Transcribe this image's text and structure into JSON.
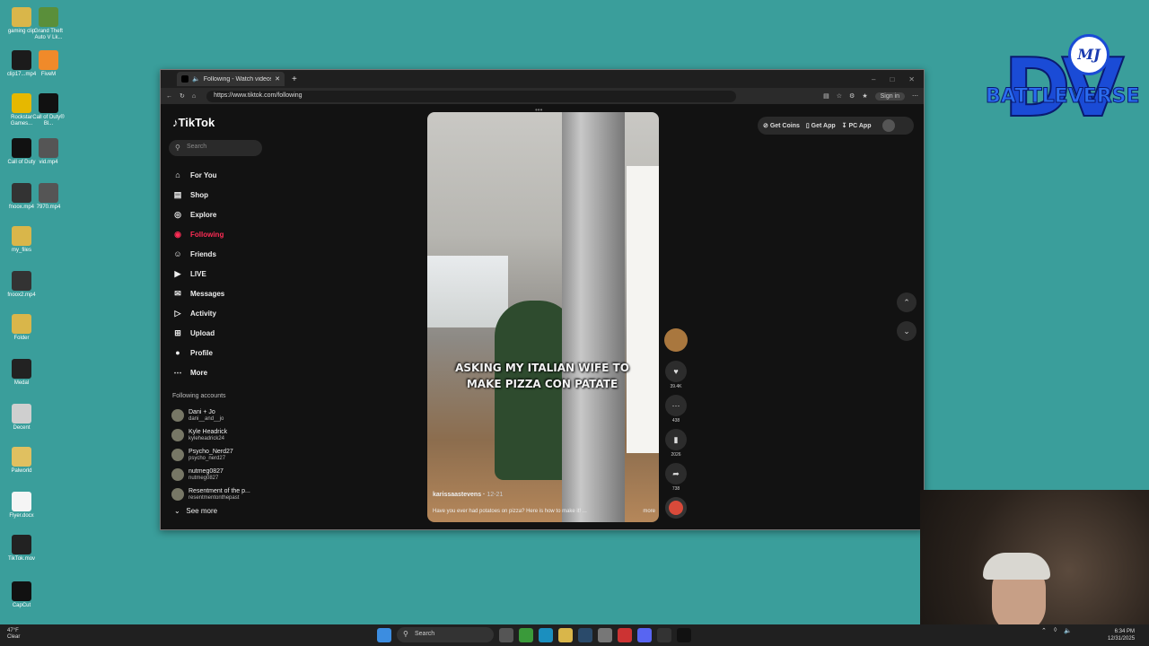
{
  "desktop": {
    "icons": [
      {
        "label": "gaming clip",
        "color": "#d9b64a"
      },
      {
        "label": "Grand Theft Auto V Lk...",
        "color": "#5a8f3a"
      },
      {
        "label": "clip17...mp4",
        "color": "#1b1b1b"
      },
      {
        "label": "FiveM",
        "color": "#f08a2a"
      },
      {
        "label": "Rockstar Games...",
        "color": "#e6b800"
      },
      {
        "label": "Call of Duty® Bl...",
        "color": "#111111"
      },
      {
        "label": "Call of Duty",
        "color": "#111111"
      },
      {
        "label": "vid.mp4",
        "color": "#555555"
      },
      {
        "label": "fnoox.mp4",
        "color": "#333333"
      },
      {
        "label": "7970.mp4",
        "color": "#555555"
      },
      {
        "label": "my_files",
        "color": "#d9b64a"
      },
      {
        "label": "fnoox2.mp4",
        "color": "#333333"
      },
      {
        "label": "Folder",
        "color": "#d9b64a"
      },
      {
        "label": "Medal",
        "color": "#222222"
      },
      {
        "label": "Decent",
        "color": "#cfcfcf"
      },
      {
        "label": "Palworld",
        "color": "#e0c060"
      },
      {
        "label": "Flyer.docx",
        "color": "#f5f5f5"
      },
      {
        "label": "TikTok.mov",
        "color": "#222222"
      },
      {
        "label": "CapCut",
        "color": "#111111"
      }
    ]
  },
  "branding": {
    "badge": "MJ",
    "initials": "DV",
    "name": "BATTLEVERSE"
  },
  "browser": {
    "tab_title": "Following - Watch videos fro...",
    "url": "https://www.tiktok.com/following",
    "signin": "Sign in",
    "window_controls": [
      "–",
      "□",
      "✕"
    ]
  },
  "tiktok": {
    "logo": "TikTok",
    "search_placeholder": "Search",
    "nav": [
      {
        "label": "For You",
        "icon": "⌂"
      },
      {
        "label": "Shop",
        "icon": "▤"
      },
      {
        "label": "Explore",
        "icon": "◎"
      },
      {
        "label": "Following",
        "icon": "◉"
      },
      {
        "label": "Friends",
        "icon": "☺"
      },
      {
        "label": "LIVE",
        "icon": "▶"
      },
      {
        "label": "Messages",
        "icon": "✉"
      },
      {
        "label": "Activity",
        "icon": "▷"
      },
      {
        "label": "Upload",
        "icon": "⊞"
      },
      {
        "label": "Profile",
        "icon": "●"
      },
      {
        "label": "More",
        "icon": "⋯"
      }
    ],
    "following_title": "Following accounts",
    "following_accounts": [
      {
        "name": "Dani + Jo",
        "handle": "dani__and__jo"
      },
      {
        "name": "Kyle Headrick",
        "handle": "kyleheadrick24"
      },
      {
        "name": "Psycho_Nerd27",
        "handle": "psycho_nerd27"
      },
      {
        "name": "nutmeg0827",
        "handle": "nutmeg0827"
      },
      {
        "name": "Resentment of the p...",
        "handle": "resentmentonthepast"
      }
    ],
    "see_more": "See more",
    "top_buttons": {
      "coins": "Get Coins",
      "app": "Get App",
      "pc_app": "PC App"
    },
    "video": {
      "caption": "ASKING MY ITALIAN WIFE TO MAKE PIZZA CON PATATE",
      "author": "karissaastevens",
      "date": "12-21",
      "description": "Have you ever had potatoes on pizza? Here is how to make it! ...",
      "more": "more"
    },
    "actions": {
      "likes": "39.4K",
      "comments": "438",
      "saves": "2026",
      "shares": "738"
    }
  },
  "taskbar": {
    "weather_temp": "47°F",
    "weather_desc": "Clear",
    "search": "Search",
    "time": "6:34 PM",
    "date": "12/31/2025"
  }
}
